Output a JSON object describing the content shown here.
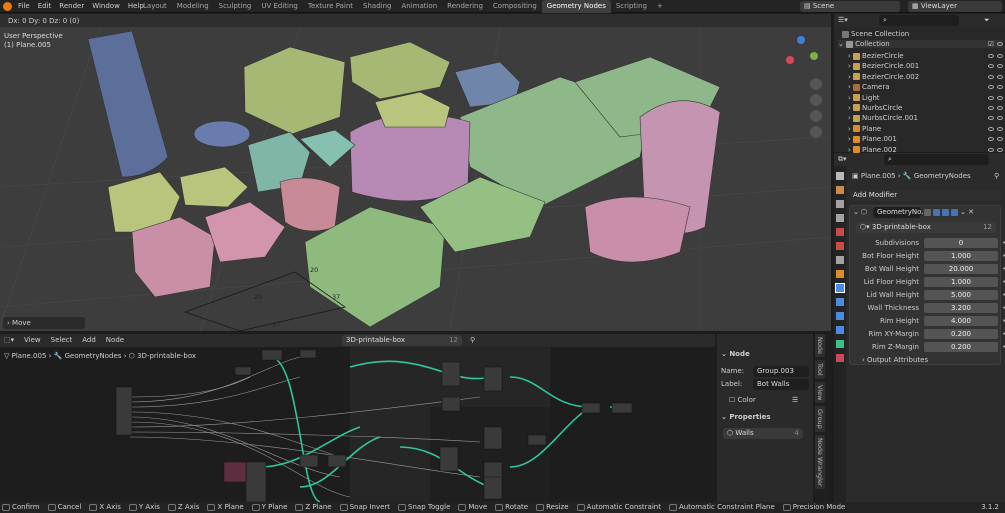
{
  "menu": [
    "File",
    "Edit",
    "Render",
    "Window",
    "Help"
  ],
  "workspaces": [
    {
      "label": "Layout",
      "active": false
    },
    {
      "label": "Modeling",
      "active": false
    },
    {
      "label": "Sculpting",
      "active": false
    },
    {
      "label": "UV Editing",
      "active": false
    },
    {
      "label": "Texture Paint",
      "active": false
    },
    {
      "label": "Shading",
      "active": false
    },
    {
      "label": "Animation",
      "active": false
    },
    {
      "label": "Rendering",
      "active": false
    },
    {
      "label": "Compositing",
      "active": false
    },
    {
      "label": "Geometry Nodes",
      "active": true
    },
    {
      "label": "Scripting",
      "active": false
    },
    {
      "label": "+",
      "active": false
    }
  ],
  "scene": "Scene",
  "view_layer": "ViewLayer",
  "viewport": {
    "header": "Dx: 0    Dy: 0    Dz: 0  (0)",
    "view_name": "User Perspective",
    "object_info": "(1) Plane.005",
    "operator_panel": "Move",
    "dims": [
      "20",
      "20",
      "37",
      "37"
    ]
  },
  "node_editor": {
    "menus": [
      "View",
      "Select",
      "Add",
      "Node"
    ],
    "tree_name": "3D-printable-box",
    "users": "12",
    "breadcrumb": [
      "Plane.005",
      "GeometryNodes",
      "3D-printable-box"
    ]
  },
  "node_panel": {
    "section": "Node",
    "name_label": "Name:",
    "name_value": "Group.003",
    "label_label": "Label:",
    "label_value": "Bot Walls",
    "color": "Color",
    "properties": "Properties",
    "group_name": "Walls",
    "group_users": "4"
  },
  "side_tabs": [
    "Node",
    "Tool",
    "View",
    "Group",
    "Node Wrangler"
  ],
  "outliner": {
    "root": "Scene Collection",
    "collection": "Collection",
    "items": [
      {
        "name": "BezierCircle",
        "color": "#c8a24a"
      },
      {
        "name": "BezierCircle.001",
        "color": "#c8a24a"
      },
      {
        "name": "BezierCircle.002",
        "color": "#c8a24a"
      },
      {
        "name": "Camera",
        "color": "#a86b3a"
      },
      {
        "name": "Light",
        "color": "#c8a24a"
      },
      {
        "name": "NurbsCircle",
        "color": "#c8a24a"
      },
      {
        "name": "NurbsCircle.001",
        "color": "#c8a24a"
      },
      {
        "name": "Plane",
        "color": "#e08a2a"
      },
      {
        "name": "Plane.001",
        "color": "#e08a2a"
      },
      {
        "name": "Plane.002",
        "color": "#e08a2a"
      }
    ]
  },
  "properties": {
    "object": "Plane.005",
    "modifier_tab": "GeometryNodes",
    "add_modifier": "Add Modifier",
    "modifier_name": "GeometryNo..",
    "node_group": "3D-printable-box",
    "node_group_users": "12",
    "inputs": [
      {
        "label": "Subdivisions",
        "value": "0"
      },
      {
        "label": "Bot Floor Height",
        "value": "1.000"
      },
      {
        "label": "Bot Wall Height",
        "value": "20.000"
      },
      {
        "label": "Lid Floor Height",
        "value": "1.000"
      },
      {
        "label": "Lid Wall Height",
        "value": "5.000"
      },
      {
        "label": "Wall Thickness",
        "value": "3.200"
      },
      {
        "label": "Rim Height",
        "value": "4.000"
      },
      {
        "label": "Rim XY-Margin",
        "value": "0.200"
      },
      {
        "label": "Rim Z-Margin",
        "value": "0.200"
      }
    ],
    "output_attributes": "Output Attributes"
  },
  "statusbar": [
    {
      "key": "",
      "label": "Confirm"
    },
    {
      "key": "",
      "label": "Cancel"
    },
    {
      "key": "X",
      "label": "X Axis"
    },
    {
      "key": "Y",
      "label": "Y Axis"
    },
    {
      "key": "Z",
      "label": "Z Axis"
    },
    {
      "key": "X",
      "label": "X Plane"
    },
    {
      "key": "Y",
      "label": "Y Plane"
    },
    {
      "key": "Z",
      "label": "Z Plane"
    },
    {
      "key": "",
      "label": "Snap Invert"
    },
    {
      "key": "",
      "label": "Snap Toggle"
    },
    {
      "key": "G",
      "label": "Move"
    },
    {
      "key": "R",
      "label": "Rotate"
    },
    {
      "key": "S",
      "label": "Resize"
    },
    {
      "key": "",
      "label": "Automatic Constraint"
    },
    {
      "key": "",
      "label": "Automatic Constraint Plane"
    },
    {
      "key": "",
      "label": "Precision Mode"
    }
  ],
  "version": "3.1.2",
  "colors": {
    "accent": "#4772b3",
    "node_wire": "#2fc6a0",
    "mesh_green": "#8fb07a",
    "mesh_pink": "#c48aa4"
  }
}
